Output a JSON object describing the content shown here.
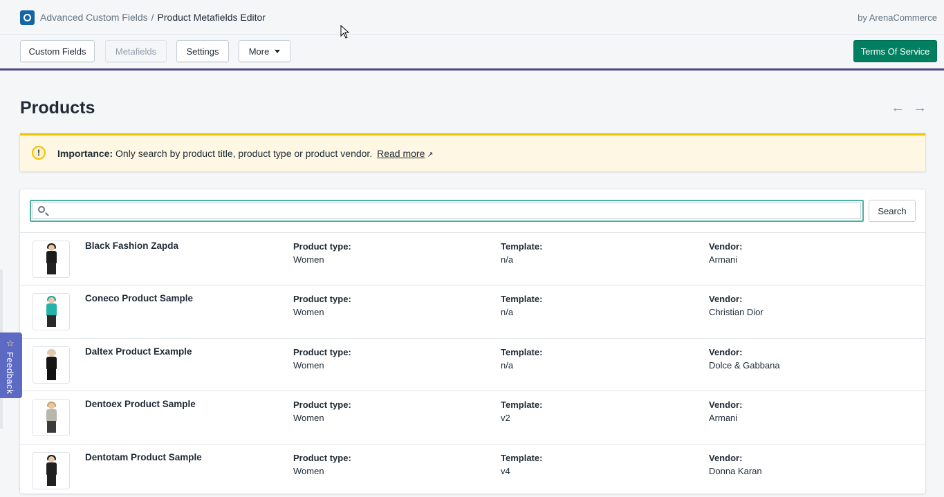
{
  "header": {
    "app_name": "Advanced Custom Fields",
    "separator": "/",
    "page_name": "Product Metafields Editor",
    "byline": "by ArenaCommerce"
  },
  "nav": {
    "custom_fields": "Custom Fields",
    "metafields": "Metafields",
    "settings": "Settings",
    "more": "More",
    "terms": "Terms Of Service"
  },
  "page": {
    "title": "Products",
    "prev_arrow": "←",
    "next_arrow": "→"
  },
  "banner": {
    "label": "Importance:",
    "text": "Only search by product title, product type or product vendor.",
    "link": "Read more",
    "icon": "!"
  },
  "search": {
    "value": "",
    "placeholder": "",
    "button": "Search"
  },
  "labels": {
    "product_type": "Product type:",
    "template": "Template:",
    "vendor": "Vendor:"
  },
  "products": [
    {
      "name": "Black Fashion Zapda",
      "type": "Women",
      "template": "n/a",
      "vendor": "Armani"
    },
    {
      "name": "Coneco Product Sample",
      "type": "Women",
      "template": "n/a",
      "vendor": "Christian Dior"
    },
    {
      "name": "Daltex Product Example",
      "type": "Women",
      "template": "n/a",
      "vendor": "Dolce & Gabbana"
    },
    {
      "name": "Dentoex Product Sample",
      "type": "Women",
      "template": "v2",
      "vendor": "Armani"
    },
    {
      "name": "Dentotam Product Sample",
      "type": "Women",
      "template": "v4",
      "vendor": "Donna Karan"
    }
  ],
  "feedback": {
    "label": "Feedback",
    "star": "☆"
  },
  "colors": {
    "accent_nav_border": "#47478a",
    "primary_button": "#008060",
    "banner_border": "#eec200",
    "search_focus": "#47b39d",
    "feedback_tab": "#5c6ac4"
  }
}
